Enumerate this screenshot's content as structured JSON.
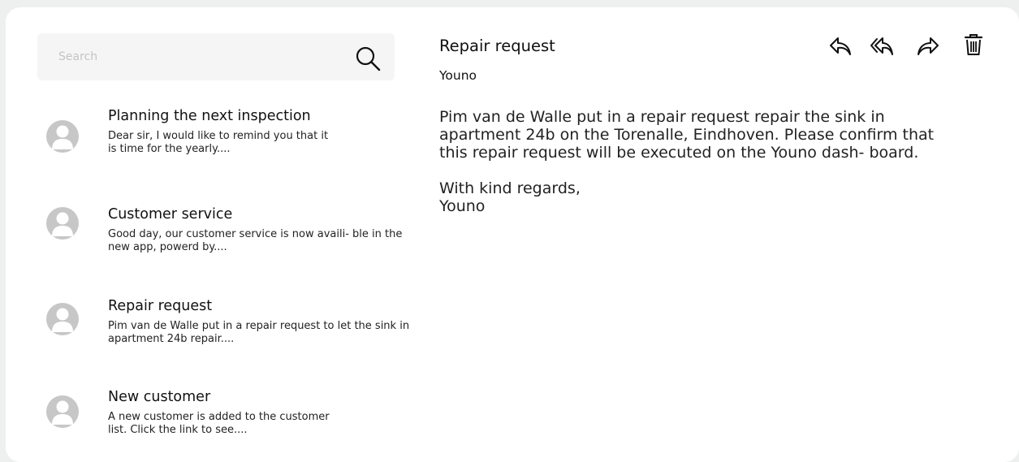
{
  "search": {
    "placeholder": "Search"
  },
  "messages": [
    {
      "title": "Planning the next inspection",
      "preview": "Dear sir, I would like to remind you that it is time for the yearly...."
    },
    {
      "title": "Customer service",
      "preview": "Good day, our customer service is now availi- ble in the new app, powerd by...."
    },
    {
      "title": "Repair request",
      "preview": "Pim van de Walle put in a repair request to let the sink in apartment 24b repair...."
    },
    {
      "title": "New customer",
      "preview": "A new customer is added to the customer list. Click the link to see...."
    }
  ],
  "detail": {
    "title": "Repair request",
    "sender": "Youno",
    "body": "Pim van de Walle put in a repair request repair the sink in apartment 24b on the Torenalle, Eindhoven.  Please confirm that this repair request will be executed on the Youno dash- board.",
    "closing": "With kind regards,",
    "signature": "Youno"
  },
  "actions": [
    {
      "icon": "reply-icon"
    },
    {
      "icon": "reply-all-icon"
    },
    {
      "icon": "forward-icon"
    },
    {
      "icon": "trash-icon"
    }
  ],
  "colors": {
    "background": "#eef0ef",
    "card": "#ffffff",
    "search_bg": "#f5f5f5",
    "avatar": "#c7c7c7"
  }
}
